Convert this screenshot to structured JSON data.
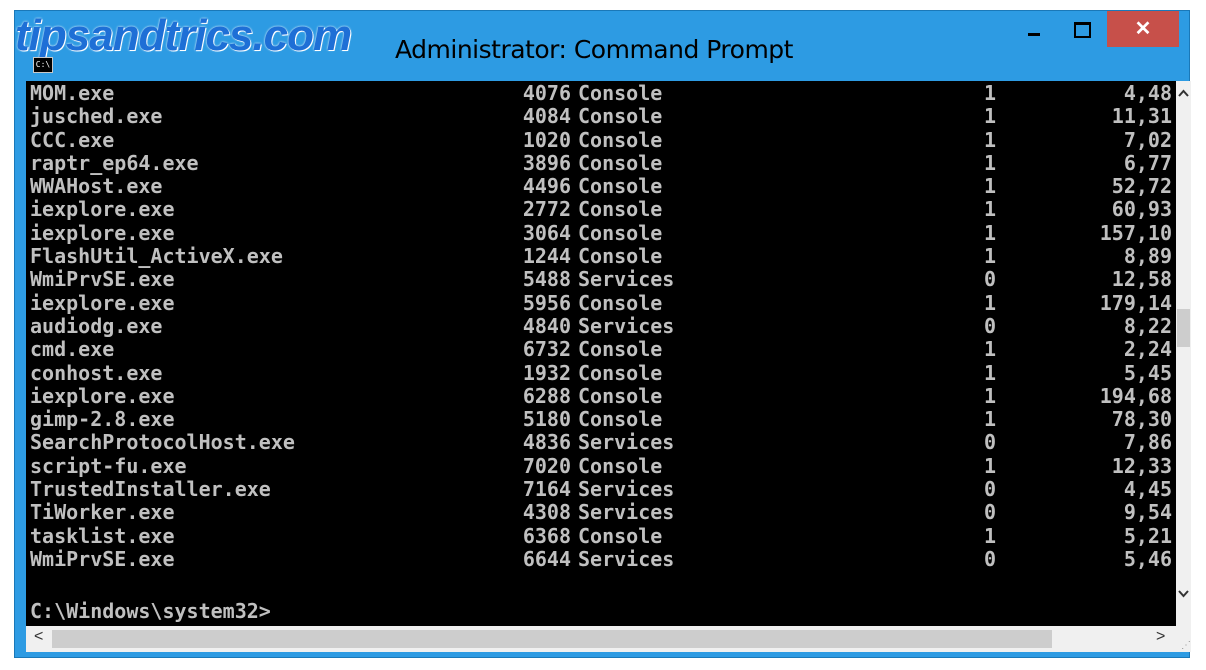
{
  "watermark": "tipsandtrics.com",
  "window": {
    "title": "Administrator: Command Prompt",
    "icon": "cmd-icon",
    "icon_text": "C:\\",
    "minimize": "minimize-icon",
    "maximize": "maximize-icon",
    "close_label": "✕"
  },
  "colors": {
    "title_bar": "#2d9be3",
    "close_button": "#c7504a",
    "console_bg": "#000000",
    "console_text": "#c0c0c0"
  },
  "processes": [
    {
      "name": "MOM.exe",
      "pid": "4076",
      "session": "Console",
      "num": "1",
      "mem": "4,48"
    },
    {
      "name": "jusched.exe",
      "pid": "4084",
      "session": "Console",
      "num": "1",
      "mem": "11,31"
    },
    {
      "name": "CCC.exe",
      "pid": "1020",
      "session": "Console",
      "num": "1",
      "mem": "7,02"
    },
    {
      "name": "raptr_ep64.exe",
      "pid": "3896",
      "session": "Console",
      "num": "1",
      "mem": "6,77"
    },
    {
      "name": "WWAHost.exe",
      "pid": "4496",
      "session": "Console",
      "num": "1",
      "mem": "52,72"
    },
    {
      "name": "iexplore.exe",
      "pid": "2772",
      "session": "Console",
      "num": "1",
      "mem": "60,93"
    },
    {
      "name": "iexplore.exe",
      "pid": "3064",
      "session": "Console",
      "num": "1",
      "mem": "157,10"
    },
    {
      "name": "FlashUtil_ActiveX.exe",
      "pid": "1244",
      "session": "Console",
      "num": "1",
      "mem": "8,89"
    },
    {
      "name": "WmiPrvSE.exe",
      "pid": "5488",
      "session": "Services",
      "num": "0",
      "mem": "12,58"
    },
    {
      "name": "iexplore.exe",
      "pid": "5956",
      "session": "Console",
      "num": "1",
      "mem": "179,14"
    },
    {
      "name": "audiodg.exe",
      "pid": "4840",
      "session": "Services",
      "num": "0",
      "mem": "8,22"
    },
    {
      "name": "cmd.exe",
      "pid": "6732",
      "session": "Console",
      "num": "1",
      "mem": "2,24"
    },
    {
      "name": "conhost.exe",
      "pid": "1932",
      "session": "Console",
      "num": "1",
      "mem": "5,45"
    },
    {
      "name": "iexplore.exe",
      "pid": "6288",
      "session": "Console",
      "num": "1",
      "mem": "194,68"
    },
    {
      "name": "gimp-2.8.exe",
      "pid": "5180",
      "session": "Console",
      "num": "1",
      "mem": "78,30"
    },
    {
      "name": "SearchProtocolHost.exe",
      "pid": "4836",
      "session": "Services",
      "num": "0",
      "mem": "7,86"
    },
    {
      "name": "script-fu.exe",
      "pid": "7020",
      "session": "Console",
      "num": "1",
      "mem": "12,33"
    },
    {
      "name": "TrustedInstaller.exe",
      "pid": "7164",
      "session": "Services",
      "num": "0",
      "mem": "4,45"
    },
    {
      "name": "TiWorker.exe",
      "pid": "4308",
      "session": "Services",
      "num": "0",
      "mem": "9,54"
    },
    {
      "name": "tasklist.exe",
      "pid": "6368",
      "session": "Console",
      "num": "1",
      "mem": "5,21"
    },
    {
      "name": "WmiPrvSE.exe",
      "pid": "6644",
      "session": "Services",
      "num": "0",
      "mem": "5,46"
    }
  ],
  "prompt": "C:\\Windows\\system32>",
  "scrollbars": {
    "up": "▲",
    "down": "⌄",
    "left": "<",
    "right": ">",
    "up_icon": "chevron-up-icon",
    "down_icon": "chevron-down-icon",
    "left_icon": "chevron-left-icon",
    "right_icon": "chevron-right-icon",
    "grip": "⋰"
  }
}
